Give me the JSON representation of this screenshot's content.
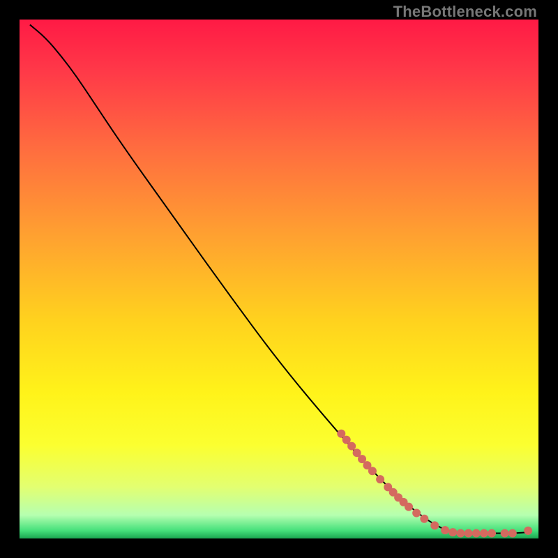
{
  "watermark": "TheBottleneck.com",
  "chart_data": {
    "type": "line",
    "title": "",
    "xlabel": "",
    "ylabel": "",
    "xlim": [
      0,
      100
    ],
    "ylim": [
      0,
      100
    ],
    "grid": false,
    "legend": false,
    "background_gradient": {
      "stops": [
        {
          "offset": 0.0,
          "color": "#ff1a45"
        },
        {
          "offset": 0.1,
          "color": "#ff3948"
        },
        {
          "offset": 0.25,
          "color": "#ff6d3f"
        },
        {
          "offset": 0.42,
          "color": "#ffa230"
        },
        {
          "offset": 0.58,
          "color": "#ffd21e"
        },
        {
          "offset": 0.72,
          "color": "#fff31a"
        },
        {
          "offset": 0.82,
          "color": "#fbff30"
        },
        {
          "offset": 0.9,
          "color": "#e3ff70"
        },
        {
          "offset": 0.955,
          "color": "#b6ffb0"
        },
        {
          "offset": 0.985,
          "color": "#44e07a"
        },
        {
          "offset": 1.0,
          "color": "#1aa651"
        }
      ]
    },
    "series": [
      {
        "name": "curve",
        "stroke": "#000000",
        "points": [
          {
            "x": 2,
            "y": 99
          },
          {
            "x": 5,
            "y": 96.5
          },
          {
            "x": 8,
            "y": 93
          },
          {
            "x": 11,
            "y": 89
          },
          {
            "x": 14,
            "y": 84.5
          },
          {
            "x": 20,
            "y": 75.5
          },
          {
            "x": 30,
            "y": 61.5
          },
          {
            "x": 40,
            "y": 47.5
          },
          {
            "x": 50,
            "y": 34
          },
          {
            "x": 60,
            "y": 22
          },
          {
            "x": 68,
            "y": 13
          },
          {
            "x": 74,
            "y": 7
          },
          {
            "x": 80,
            "y": 2.5
          },
          {
            "x": 84,
            "y": 1
          },
          {
            "x": 90,
            "y": 1
          },
          {
            "x": 95,
            "y": 1
          },
          {
            "x": 98,
            "y": 1.2
          }
        ]
      }
    ],
    "markers": [
      {
        "x": 62,
        "y": 20.2
      },
      {
        "x": 63,
        "y": 19.0
      },
      {
        "x": 64,
        "y": 17.8
      },
      {
        "x": 65,
        "y": 16.5
      },
      {
        "x": 66,
        "y": 15.3
      },
      {
        "x": 67,
        "y": 14.1
      },
      {
        "x": 68,
        "y": 13.0
      },
      {
        "x": 69.5,
        "y": 11.4
      },
      {
        "x": 71,
        "y": 9.9
      },
      {
        "x": 72,
        "y": 8.9
      },
      {
        "x": 73,
        "y": 7.9
      },
      {
        "x": 74,
        "y": 7.0
      },
      {
        "x": 75,
        "y": 6.1
      },
      {
        "x": 76.5,
        "y": 4.9
      },
      {
        "x": 78,
        "y": 3.8
      },
      {
        "x": 80,
        "y": 2.5
      },
      {
        "x": 82,
        "y": 1.6
      },
      {
        "x": 83.5,
        "y": 1.2
      },
      {
        "x": 85,
        "y": 1.0
      },
      {
        "x": 86.5,
        "y": 1.0
      },
      {
        "x": 88,
        "y": 1.0
      },
      {
        "x": 89.5,
        "y": 1.0
      },
      {
        "x": 91,
        "y": 1.0
      },
      {
        "x": 93.5,
        "y": 1.0
      },
      {
        "x": 95,
        "y": 1.0
      },
      {
        "x": 98,
        "y": 1.5
      }
    ],
    "marker_style": {
      "radius_px": 6,
      "fill": "#d46a5f"
    }
  }
}
